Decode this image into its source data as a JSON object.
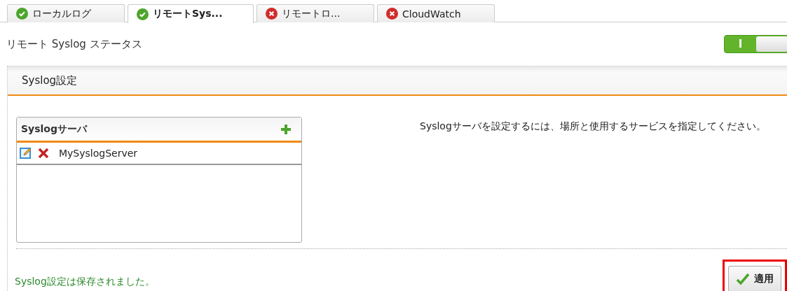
{
  "tabs": [
    {
      "label": "ローカルログ",
      "kind": "ok",
      "selected": false
    },
    {
      "label": "リモートSys...",
      "kind": "ok",
      "selected": true
    },
    {
      "label": "リモートロ...",
      "kind": "error",
      "selected": false
    },
    {
      "label": "CloudWatch",
      "kind": "error",
      "selected": false
    }
  ],
  "status_row": {
    "label": "リモート Syslog ステータス",
    "toggle": {
      "on": true,
      "label": "I"
    }
  },
  "panel": {
    "title": "Syslog設定",
    "server_list": {
      "title": "Syslogサーバ",
      "items": [
        {
          "name": "MySyslogServer"
        }
      ]
    },
    "description": "Syslogサーバを設定するには、場所と使用するサービスを指定してください。",
    "message": "Syslog設定は保存されました。",
    "apply_button": {
      "label": "適用",
      "highlighted": true
    }
  }
}
